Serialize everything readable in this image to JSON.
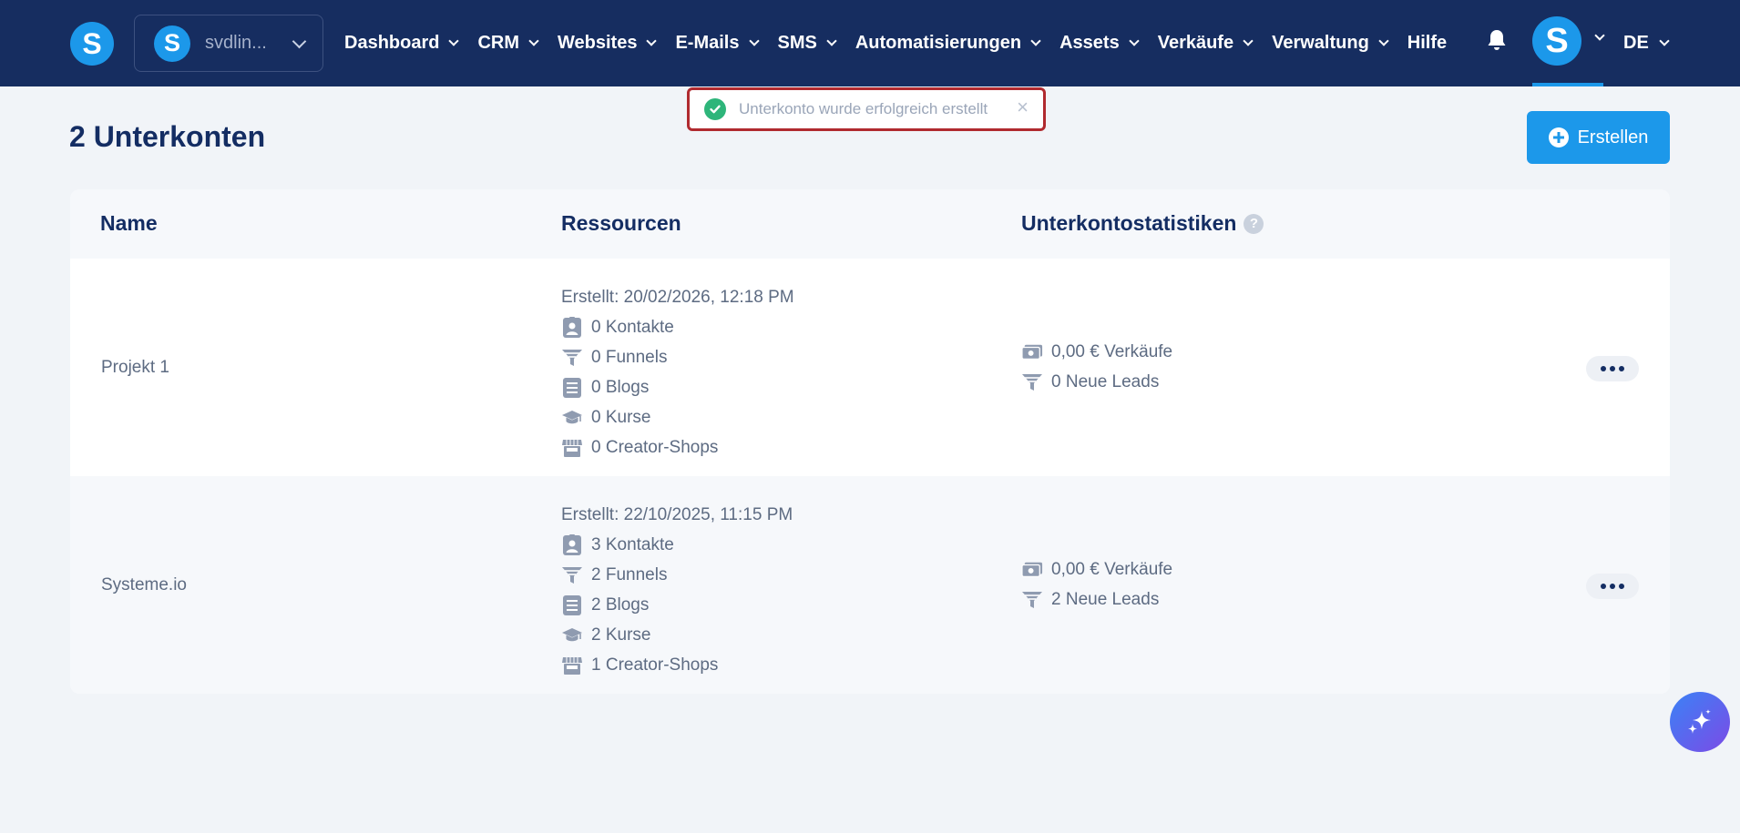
{
  "topbar": {
    "logo_letter": "S",
    "account": {
      "avatar_letter": "S",
      "name": "svdlin..."
    },
    "nav": [
      {
        "label": "Dashboard"
      },
      {
        "label": "CRM"
      },
      {
        "label": "Websites"
      },
      {
        "label": "E-Mails"
      },
      {
        "label": "SMS"
      },
      {
        "label": "Automatisierungen"
      },
      {
        "label": "Assets"
      },
      {
        "label": "Verkäufe"
      },
      {
        "label": "Verwaltung"
      }
    ],
    "help_label": "Hilfe",
    "user_avatar_letter": "S",
    "language": "DE"
  },
  "toast": {
    "message": "Unterkonto wurde erfolgreich erstellt",
    "close_glyph": "×"
  },
  "page": {
    "title": "2 Unterkonten",
    "create_label": "Erstellen"
  },
  "table": {
    "headers": {
      "name": "Name",
      "resources": "Ressourcen",
      "stats": "Unterkontostatistiken",
      "help_glyph": "?"
    },
    "rows": [
      {
        "name": "Projekt 1",
        "created": "Erstellt: 20/02/2026, 12:18 PM",
        "contacts": "0 Kontakte",
        "funnels": "0 Funnels",
        "blogs": "0 Blogs",
        "courses": "0 Kurse",
        "shops": "0 Creator-Shops",
        "sales": "0,00 € Verkäufe",
        "leads": "0 Neue Leads"
      },
      {
        "name": "Systeme.io",
        "created": "Erstellt: 22/10/2025, 11:15 PM",
        "contacts": "3 Kontakte",
        "funnels": "2 Funnels",
        "blogs": "2 Blogs",
        "courses": "2 Kurse",
        "shops": "1 Creator-Shops",
        "sales": "0,00 € Verkäufe",
        "leads": "2 Neue Leads"
      }
    ]
  },
  "colors": {
    "nav_bg": "#162d60",
    "accent": "#1c98ea",
    "success": "#2eb57a",
    "toast_highlight": "#b02a2f",
    "page_bg": "#f1f4f8"
  },
  "icons": {
    "notifications": "bell-icon",
    "contacts": "contact-card-icon",
    "funnels": "funnel-icon",
    "blogs": "document-icon",
    "courses": "graduation-cap-icon",
    "shops": "storefront-icon",
    "sales": "money-icon",
    "leads": "funnel-icon",
    "assistant": "sparkles-icon"
  }
}
